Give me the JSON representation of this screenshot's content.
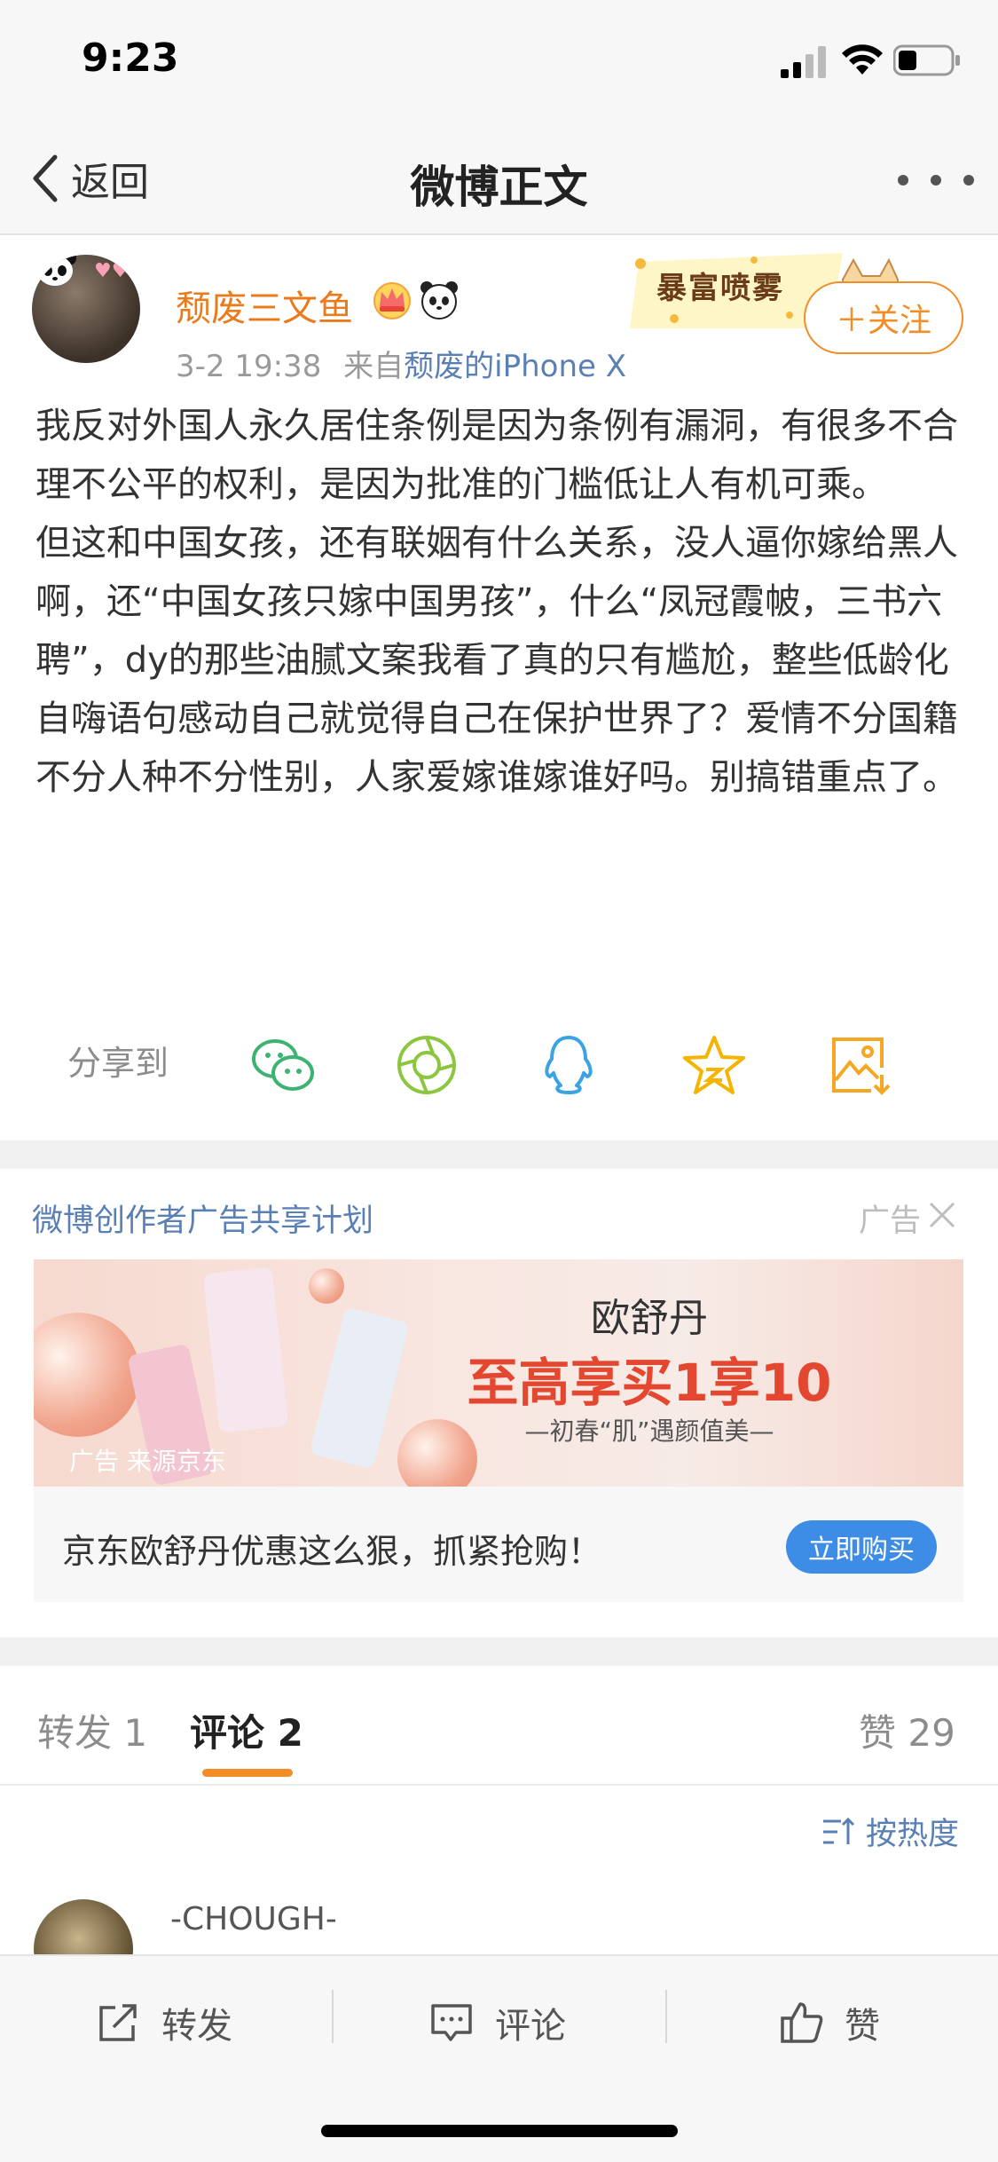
{
  "status_bar": {
    "time": "9:23"
  },
  "nav": {
    "back_label": "返回",
    "title": "微博正文"
  },
  "post": {
    "username": "颓废三文鱼",
    "timestamp": "3-2 19:38",
    "source_prefix": "来自",
    "source": "颓废的iPhone X",
    "decoration_text": "暴富喷雾",
    "follow_label": "＋关注",
    "paragraphs": [
      "我反对外国人永久居住条例是因为条例有漏洞，有很多不合理不公平的权利，是因为批准的门槛低让人有机可乘。",
      "但这和中国女孩，还有联姻有什么关系，没人逼你嫁给黑人啊，还“中国女孩只嫁中国男孩”，什么“凤冠霞帔，三书六聘”，dy的那些油腻文案我看了真的只有尴尬，整些低龄化自嗨语句感动自己就觉得自己在保护世界了？爱情不分国籍不分人种不分性别，人家爱嫁谁嫁谁好吗。别搞错重点了。"
    ]
  },
  "share": {
    "label": "分享到",
    "icons": [
      "wechat-icon",
      "moments-icon",
      "qq-icon",
      "favorite-star-icon",
      "save-image-icon"
    ]
  },
  "ad": {
    "plan_label": "微博创作者广告共享计划",
    "ad_label": "广告",
    "banner_brand": "欧舒丹",
    "banner_headline": "至高享买1享10",
    "banner_tagline": "—初春“肌”遇颜值美—",
    "banner_source": "广告 来源京东",
    "description": "京东欧舒丹优惠这么狠，抓紧抢购！",
    "buy_label": "立即购买"
  },
  "tabs": {
    "repost_label": "转发 1",
    "comment_label": "评论 2",
    "like_label": "赞 29"
  },
  "sort_label": "按热度",
  "comments": [
    {
      "name": "-CHOUGH-"
    }
  ],
  "bottom_bar": {
    "repost": "转发",
    "comment": "评论",
    "like": "赞"
  },
  "colors": {
    "accent": "#f28d27",
    "link": "#5a7fb5",
    "username": "#ea7b1d",
    "buy_button": "#3d8de6"
  }
}
